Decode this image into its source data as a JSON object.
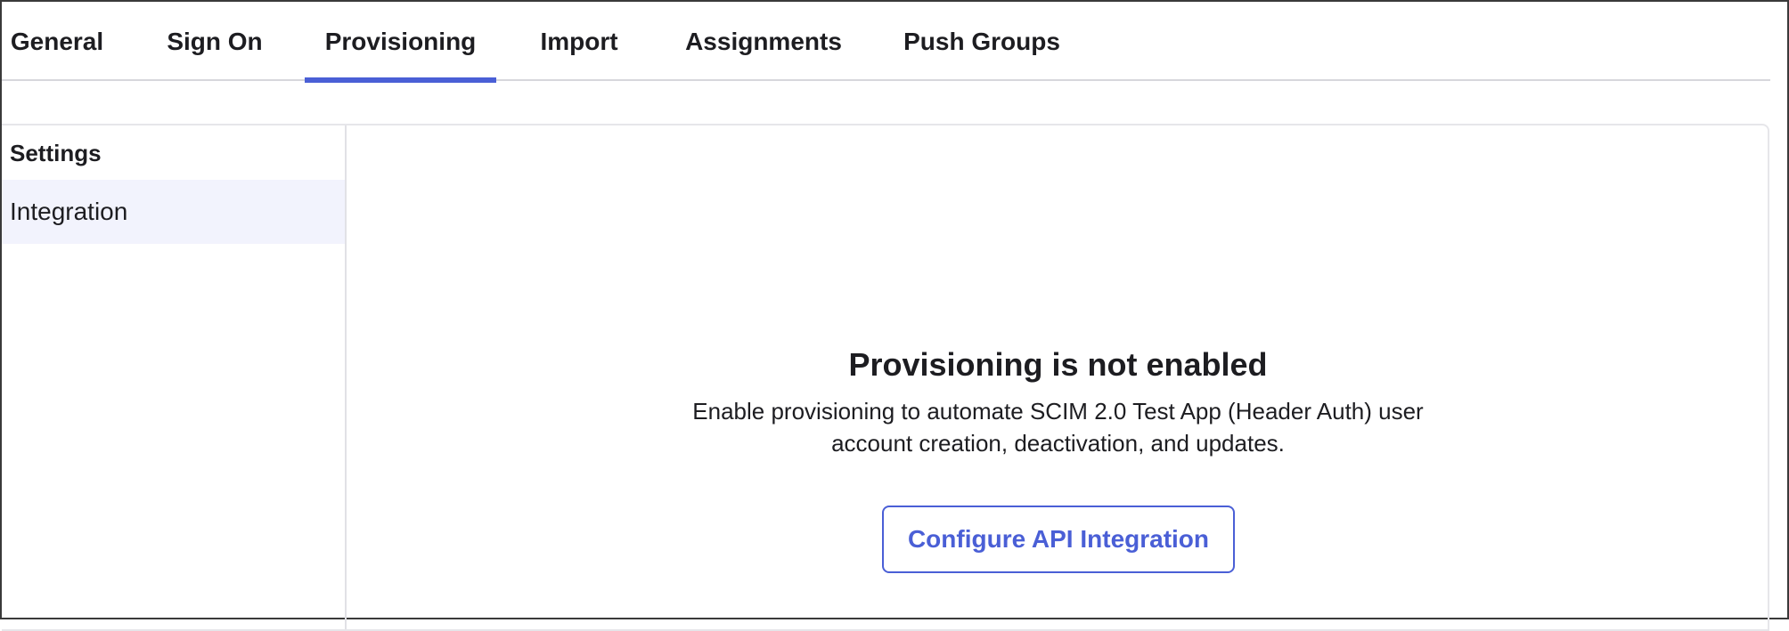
{
  "tabs": [
    {
      "label": "General",
      "active": false
    },
    {
      "label": "Sign On",
      "active": false
    },
    {
      "label": "Provisioning",
      "active": true
    },
    {
      "label": "Import",
      "active": false
    },
    {
      "label": "Assignments",
      "active": false
    },
    {
      "label": "Push Groups",
      "active": false
    }
  ],
  "sidebar": {
    "heading": "Settings",
    "items": [
      {
        "label": "Integration",
        "selected": true
      }
    ]
  },
  "main": {
    "title": "Provisioning is not enabled",
    "description_line1": "Enable provisioning to automate SCIM 2.0 Test App (Header Auth) user",
    "description_line2": "account creation, deactivation, and updates.",
    "button_label": "Configure API Integration"
  },
  "colors": {
    "accent": "#4a5fd6",
    "selected_bg": "#f2f3fd",
    "text": "#1d1d21",
    "divider": "#d7d7dc"
  }
}
